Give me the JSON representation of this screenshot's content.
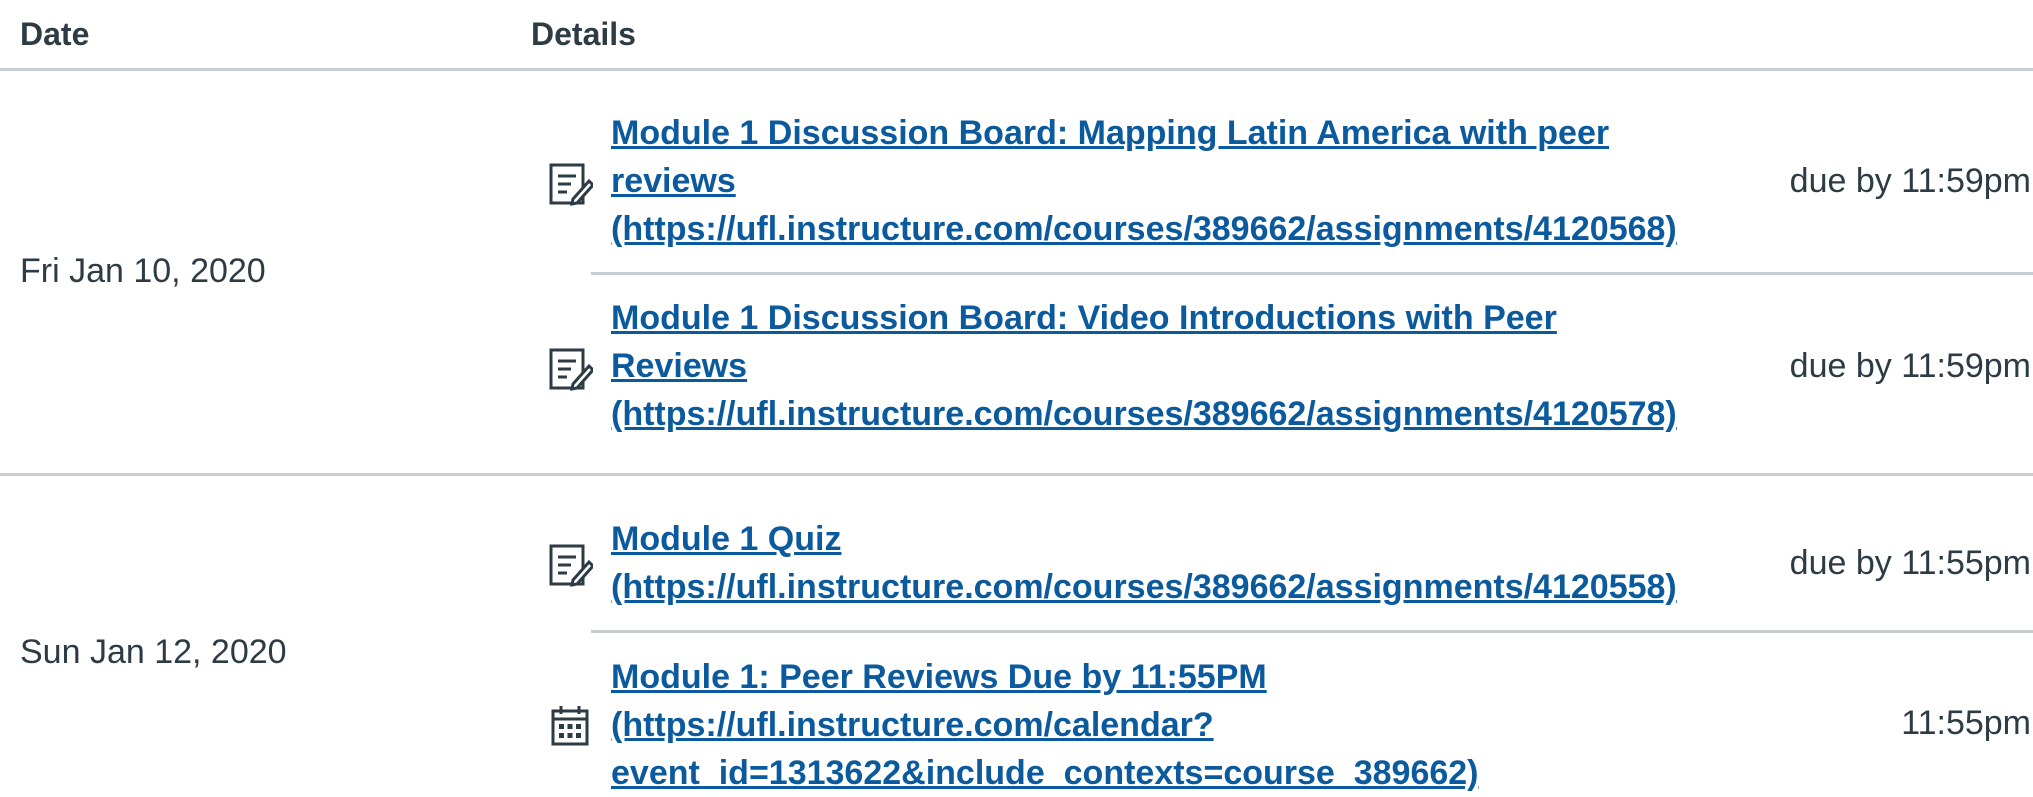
{
  "table": {
    "headers": {
      "date": "Date",
      "details": "Details"
    },
    "groups": [
      {
        "date": "Fri Jan 10, 2020",
        "items": [
          {
            "icon": "assignment-icon",
            "title_lines": [
              "Module 1 Discussion Board: Mapping Latin America with peer",
              "reviews",
              "(https://ufl.instructure.com/courses/389662/assignments/4120568)"
            ],
            "due": "due by 11:59pm"
          },
          {
            "icon": "assignment-icon",
            "title_lines": [
              "Module 1 Discussion Board: Video Introductions with Peer",
              "Reviews",
              "(https://ufl.instructure.com/courses/389662/assignments/4120578)"
            ],
            "due": "due by 11:59pm"
          }
        ]
      },
      {
        "date": "Sun Jan 12, 2020",
        "items": [
          {
            "icon": "assignment-icon",
            "title_lines": [
              "Module 1 Quiz",
              "(https://ufl.instructure.com/courses/389662/assignments/4120558)"
            ],
            "due": "due by 11:55pm"
          },
          {
            "icon": "calendar-event-icon",
            "title_lines": [
              "Module 1: Peer Reviews Due by 11:55PM",
              "(https://ufl.instructure.com/calendar?",
              "event_id=1313622&include_contexts=course_389662)"
            ],
            "due": "11:55pm"
          }
        ]
      }
    ]
  },
  "colors": {
    "link": "#0b5a9e",
    "text": "#2d3b45",
    "divider": "#c7cdd1"
  }
}
